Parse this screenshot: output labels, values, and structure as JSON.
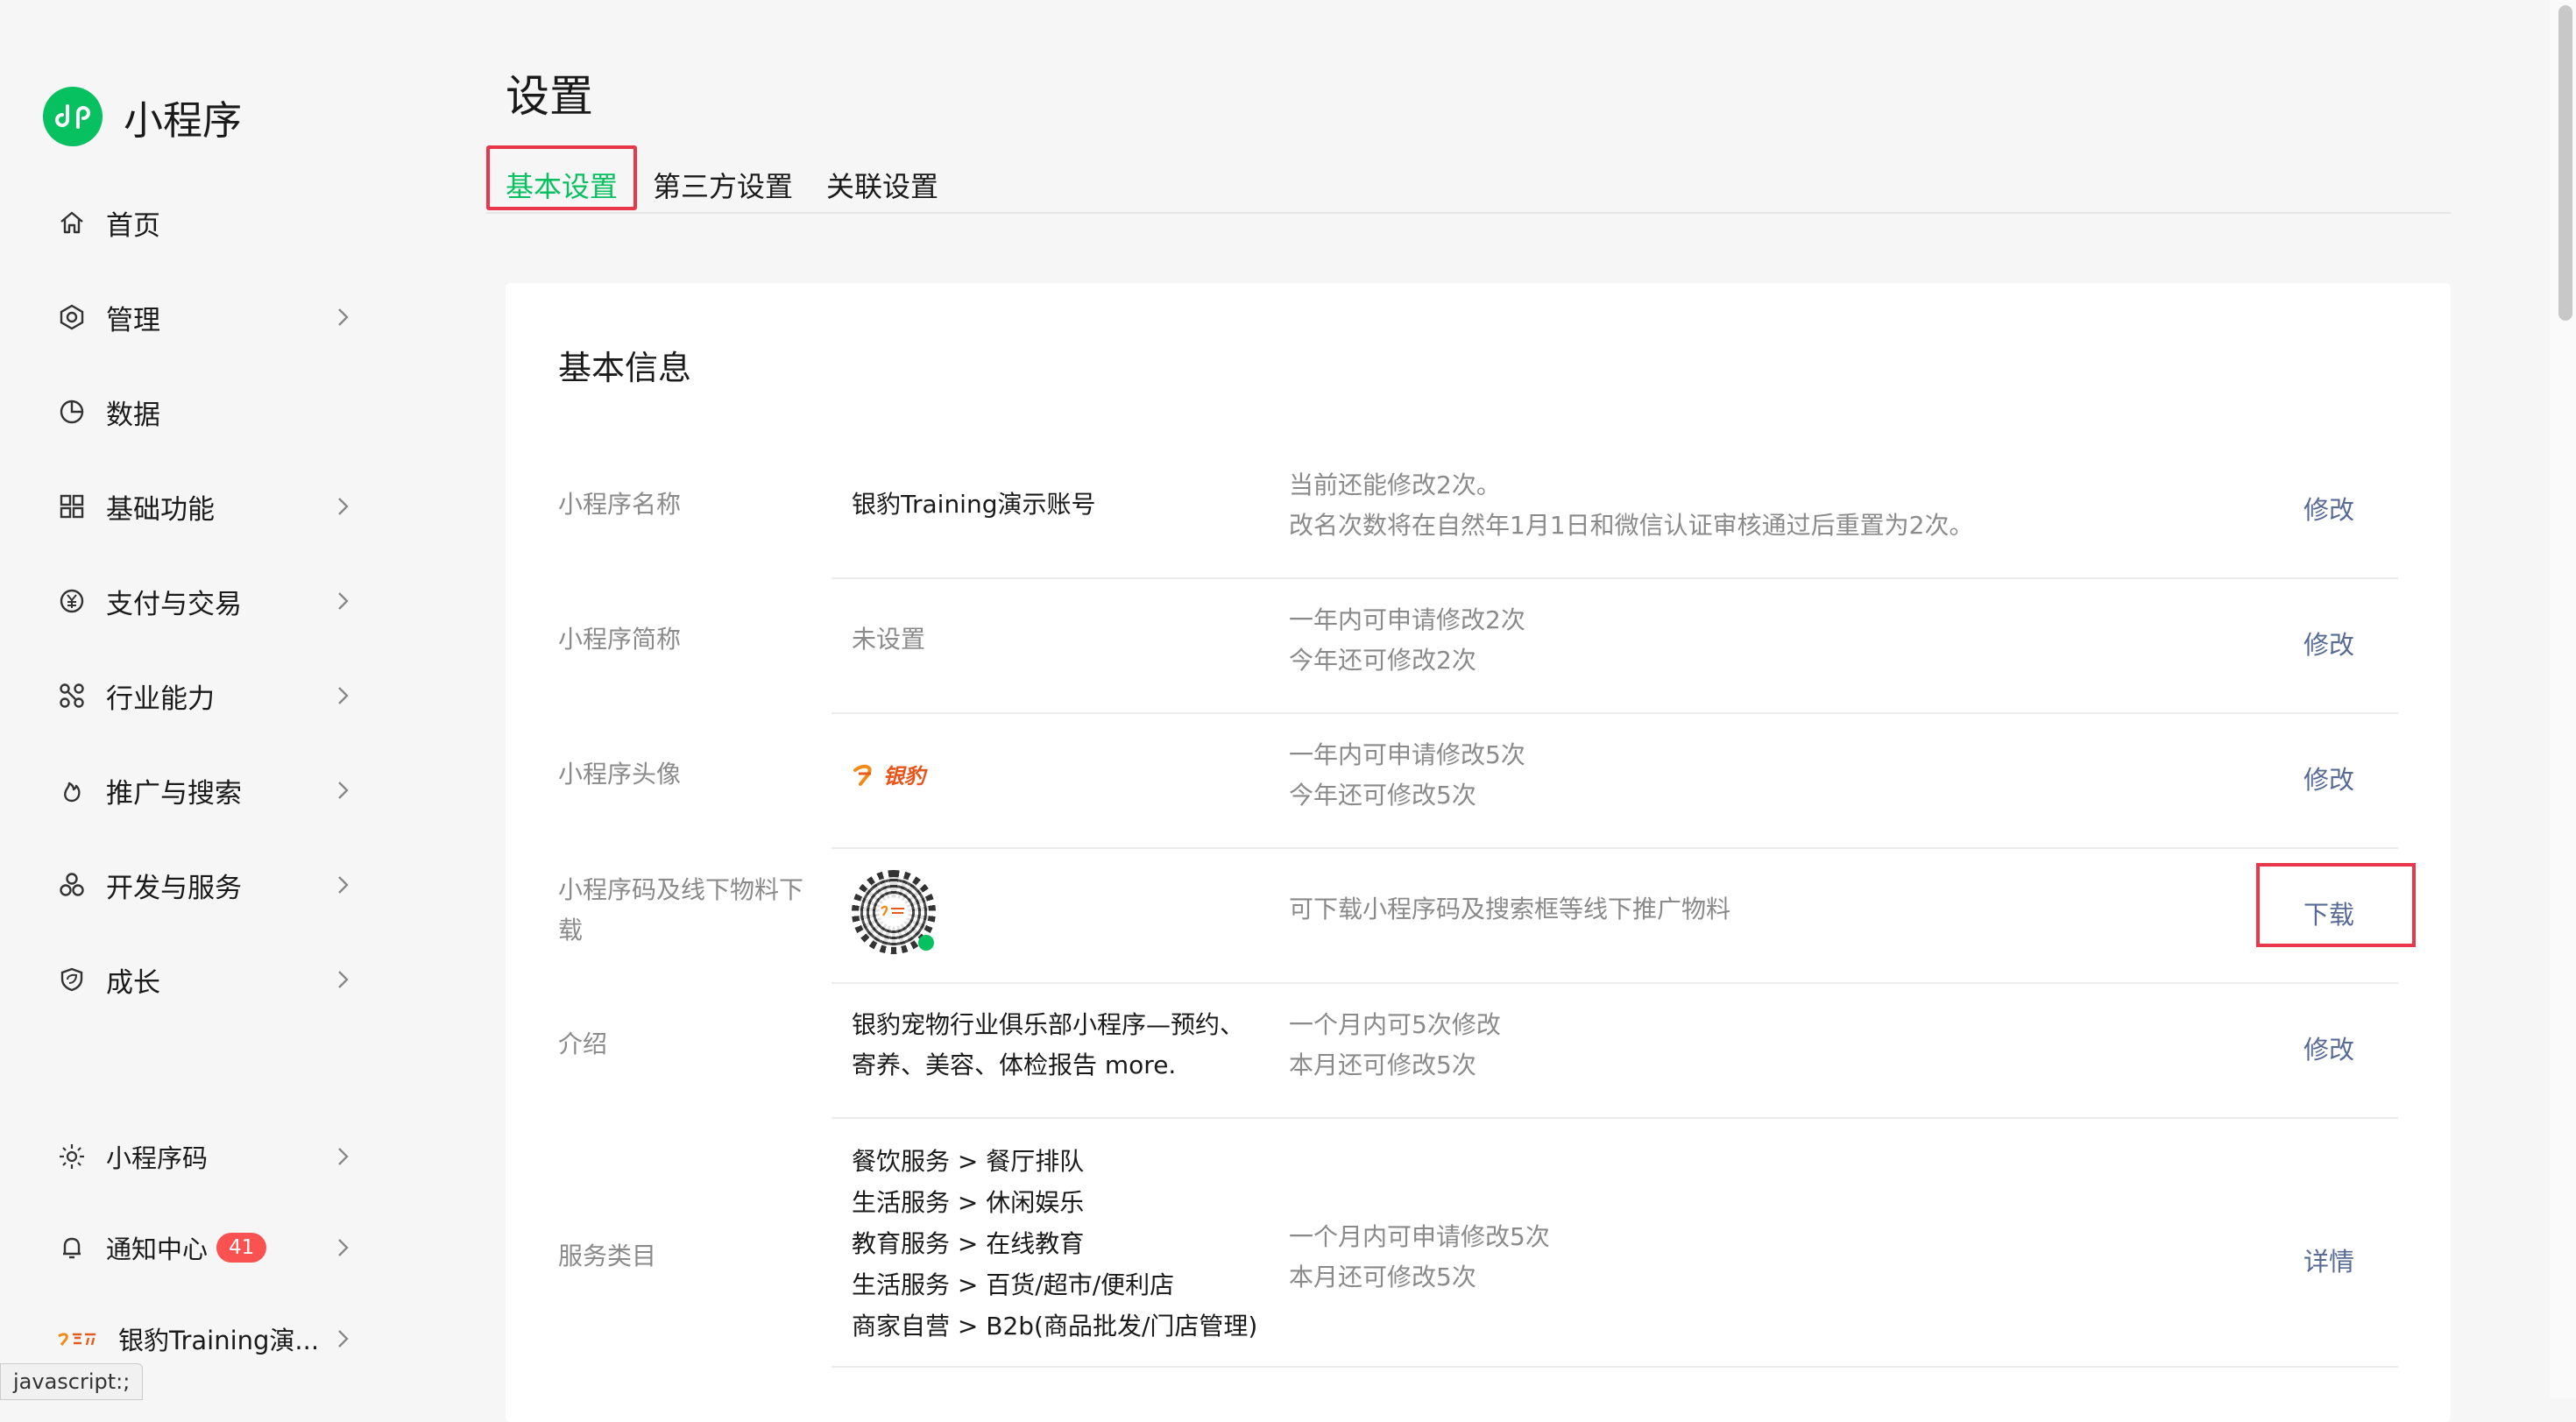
{
  "brand": {
    "name": "小程序",
    "accent": "#07c160"
  },
  "sidebar": {
    "items": [
      {
        "label": "首页",
        "icon": "home-icon",
        "has_arrow": false
      },
      {
        "label": "管理",
        "icon": "hexagon-settings-icon",
        "has_arrow": true
      },
      {
        "label": "数据",
        "icon": "pie-chart-icon",
        "has_arrow": false
      },
      {
        "label": "基础功能",
        "icon": "grid-icon",
        "has_arrow": true
      },
      {
        "label": "支付与交易",
        "icon": "yuan-icon",
        "has_arrow": true
      },
      {
        "label": "行业能力",
        "icon": "nodes-icon",
        "has_arrow": true
      },
      {
        "label": "推广与搜索",
        "icon": "flame-icon",
        "has_arrow": true
      },
      {
        "label": "开发与服务",
        "icon": "cubes-icon",
        "has_arrow": true
      },
      {
        "label": "成长",
        "icon": "shield-leaf-icon",
        "has_arrow": true
      }
    ],
    "bottom": {
      "qrcode_label": "小程序码",
      "notify_label": "通知中心",
      "notify_count": "41",
      "account_label": "银豹Training演..."
    }
  },
  "page": {
    "title": "设置",
    "tabs": [
      "基本设置",
      "第三方设置",
      "关联设置"
    ],
    "active_tab": "基本设置"
  },
  "card": {
    "title": "基本信息",
    "rows": [
      {
        "label": "小程序名称",
        "value": "银豹Training演示账号",
        "tip1": "当前还能修改2次。",
        "tip2": "改名次数将在自然年1月1日和微信认证审核通过后重置为2次。",
        "action": "修改"
      },
      {
        "label": "小程序简称",
        "value": "未设置",
        "tip1": "一年内可申请修改2次",
        "tip2": "今年还可修改2次",
        "action": "修改"
      },
      {
        "label": "小程序头像",
        "value_logo": "银豹",
        "tip1": "一年内可申请修改5次",
        "tip2": "今年还可修改5次",
        "action": "修改"
      },
      {
        "label1": "小程序码及线下物料下",
        "label2": "载",
        "tip1": "可下载小程序码及搜索框等线下推广物料",
        "action": "下载"
      },
      {
        "label": "介绍",
        "value1": "银豹宠物行业俱乐部小程序—预约、",
        "value2": "寄养、美容、体检报告 more.",
        "tip1": "一个月内可5次修改",
        "tip2": "本月还可修改5次",
        "action": "修改"
      },
      {
        "label": "服务类目",
        "values": [
          "餐饮服务 > 餐厅排队",
          "生活服务 > 休闲娱乐",
          "教育服务 > 在线教育",
          "生活服务 > 百货/超市/便利店",
          "商家自营 > B2b(商品批发/门店管理)"
        ],
        "tip1": "一个月内可申请修改5次",
        "tip2": "本月还可修改5次",
        "action": "详情"
      }
    ]
  },
  "status_bar": {
    "text": "javascript:;"
  }
}
